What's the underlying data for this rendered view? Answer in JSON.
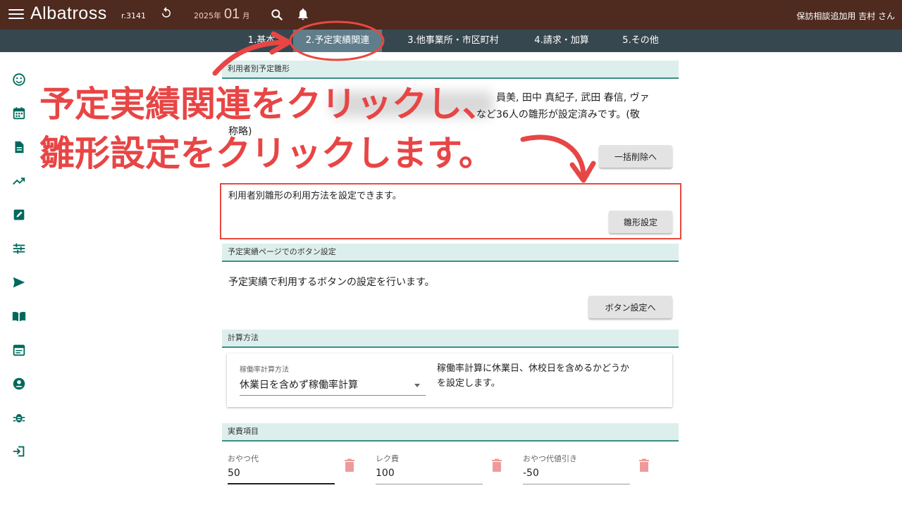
{
  "header": {
    "brand": "Albatross",
    "version": "r.3141",
    "year": "2025年",
    "month": "01",
    "month_unit": "月",
    "user": "保訪相談追加用 吉村 さん"
  },
  "tabs": [
    {
      "label": "1.基本"
    },
    {
      "label": "2.予定実績関連"
    },
    {
      "label": "3.他事業所・市区町村"
    },
    {
      "label": "4.請求・加算"
    },
    {
      "label": "5.その他"
    }
  ],
  "active_tab": "2.予定実績関連",
  "sidebar_icons": [
    "smiley-icon",
    "calendar-icon",
    "document-icon",
    "trending-icon",
    "edit-icon",
    "tune-icon",
    "send-icon",
    "book-icon",
    "event-note-icon",
    "account-circle-icon",
    "bug-icon",
    "login-icon"
  ],
  "templates": {
    "header": "利用者別予定雛形",
    "desc_line1": "員美, 田中 真紀子, 武田 春信, ヴァ",
    "desc_line2": "など36人の雛形が設定済みです。(敬",
    "desc_line3": "称略)",
    "bulk_delete_btn": "一括削除へ",
    "usage_text": "利用者別雛形の利用方法を設定できます。",
    "settings_btn": "雛形設定"
  },
  "button_settings": {
    "header": "予定実績ページでのボタン設定",
    "text": "予定実績で利用するボタンの設定を行います。",
    "btn": "ボタン設定へ"
  },
  "calc": {
    "header": "計算方法",
    "select_label": "稼働率計算方法",
    "select_value": "休業日を含めず稼働率計算",
    "desc_line1": "稼働率計算に休業日、休校日を含めるかどうか",
    "desc_line2": "を設定します。"
  },
  "expenses": {
    "header": "実費項目",
    "items": [
      {
        "label": "おやつ代",
        "value": "50"
      },
      {
        "label": "レク費",
        "value": "100"
      },
      {
        "label": "おやつ代値引き",
        "value": "-50"
      }
    ]
  },
  "annotation": {
    "line1": "予定実績関連をクリックし、",
    "line2": "雛形設定をクリックします。"
  },
  "colors": {
    "header_bg": "#4e2a1f",
    "tab_bg": "#37474f",
    "tab_active": "#607d8b",
    "accent_teal": "#3a8f86",
    "annotation_red": "#e84545"
  }
}
